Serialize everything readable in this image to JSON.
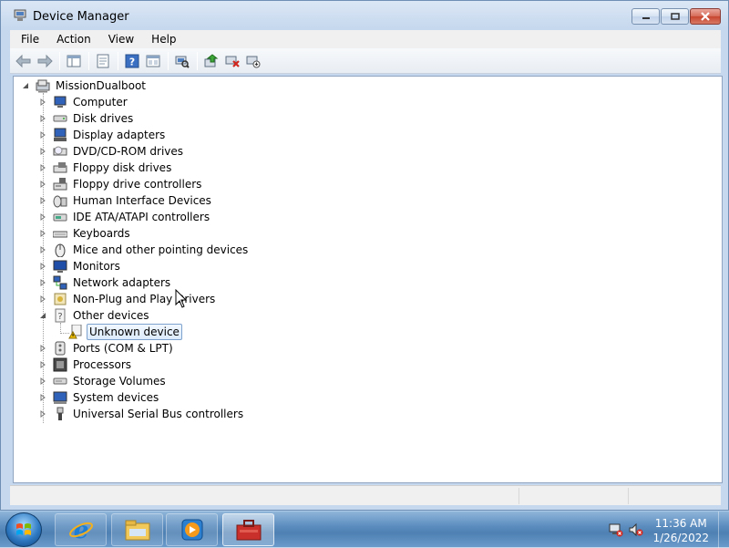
{
  "window": {
    "title": "Device Manager",
    "icon": "device-manager-icon"
  },
  "menu": {
    "items": [
      {
        "label": "File"
      },
      {
        "label": "Action"
      },
      {
        "label": "View"
      },
      {
        "label": "Help"
      }
    ]
  },
  "toolbar": {
    "buttons": [
      "back-icon",
      "forward-icon",
      "show-hide-tree-icon",
      "properties-icon",
      "help-icon",
      "view-icon",
      "scan-hardware-icon",
      "update-driver-icon",
      "uninstall-icon",
      "disable-icon"
    ]
  },
  "tree": {
    "root": "MissionDualboot",
    "categories": [
      {
        "label": "Computer"
      },
      {
        "label": "Disk drives"
      },
      {
        "label": "Display adapters"
      },
      {
        "label": "DVD/CD-ROM drives"
      },
      {
        "label": "Floppy disk drives"
      },
      {
        "label": "Floppy drive controllers"
      },
      {
        "label": "Human Interface Devices"
      },
      {
        "label": "IDE ATA/ATAPI controllers"
      },
      {
        "label": "Keyboards"
      },
      {
        "label": "Mice and other pointing devices"
      },
      {
        "label": "Monitors"
      },
      {
        "label": "Network adapters"
      },
      {
        "label": "Non-Plug and Play Drivers"
      },
      {
        "label": "Other devices",
        "expanded": true
      },
      {
        "label": "Ports (COM & LPT)"
      },
      {
        "label": "Processors"
      },
      {
        "label": "Storage Volumes"
      },
      {
        "label": "System devices"
      },
      {
        "label": "Universal Serial Bus controllers"
      }
    ],
    "child_of_other_devices": {
      "label": "Unknown device",
      "selected": true,
      "status": "warning"
    }
  },
  "taskbar": {
    "pinned": [
      "internet-explorer-icon",
      "windows-explorer-icon",
      "media-player-icon",
      "device-manager-task-icon"
    ],
    "clock": {
      "time": "11:36 AM",
      "date": "1/26/2022"
    }
  },
  "colors": {
    "title_bar": "#c6d8ee",
    "selection": "#dcebfc",
    "taskbar": "#5d8ec0"
  }
}
